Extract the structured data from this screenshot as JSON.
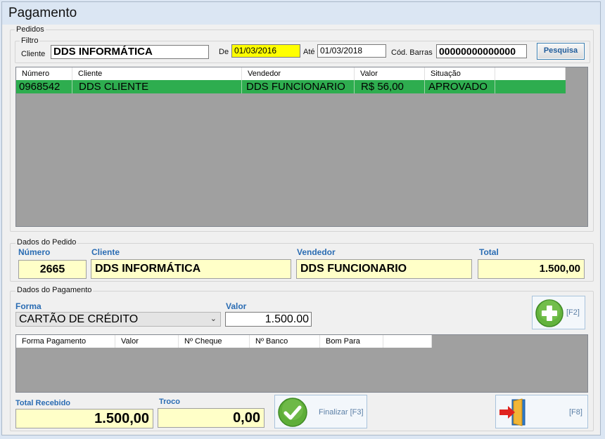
{
  "window": {
    "title": "Pagamento"
  },
  "pedidos": {
    "group_label": "Pedidos",
    "filtro": {
      "label": "Filtro",
      "cliente_label": "Cliente",
      "cliente_value": "DDS INFORMÁTICA",
      "de_label": "De",
      "de_value": "01/03/2016",
      "ate_label": "Até",
      "ate_value": "01/03/2018",
      "barras_label": "Cód. Barras",
      "barras_value": "00000000000000",
      "search_button": "Pesquisa"
    },
    "grid": {
      "columns": [
        "Número",
        "Cliente",
        "Vendedor",
        "Valor",
        "Situação"
      ],
      "rows": [
        {
          "numero": "0968542",
          "cliente": "DDS CLIENTE",
          "vendedor": "DDS FUNCIONARIO",
          "valor": "R$ 56,00",
          "situacao": "APROVADO"
        }
      ],
      "selected_color": "#2ead4f"
    }
  },
  "dados_pedido": {
    "group_label": "Dados do Pedido",
    "numero_label": "Número",
    "numero_value": "2665",
    "cliente_label": "Cliente",
    "cliente_value": "DDS INFORMÁTICA",
    "vendedor_label": "Vendedor",
    "vendedor_value": "DDS FUNCIONARIO",
    "total_label": "Total",
    "total_value": "1.500,00"
  },
  "dados_pagamento": {
    "group_label": "Dados do Pagamento",
    "forma_label": "Forma",
    "forma_value": "CARTÃO DE CRÉDITO",
    "valor_label": "Valor",
    "valor_value": "1.500.00",
    "add_button": {
      "label": "[F2]",
      "icon": "plus-circle-icon"
    },
    "grid": {
      "columns": [
        "Forma Pagamento",
        "Valor",
        "Nº Cheque",
        "Nº Banco",
        "Bom Para"
      ]
    }
  },
  "footer": {
    "total_recebido_label": "Total Recebido",
    "total_recebido_value": "1.500,00",
    "troco_label": "Troco",
    "troco_value": "0,00",
    "finalizar_button": {
      "label": "Finalizar [F3]",
      "icon": "check-circle-icon"
    },
    "exit_button": {
      "label": "[F8]",
      "icon": "exit-door-icon"
    }
  },
  "colors": {
    "label_blue": "#2a6cb3",
    "highlight_yellow": "#ffff00",
    "field_yellow": "#ffffc8",
    "accent_green": "#2ead4f"
  }
}
